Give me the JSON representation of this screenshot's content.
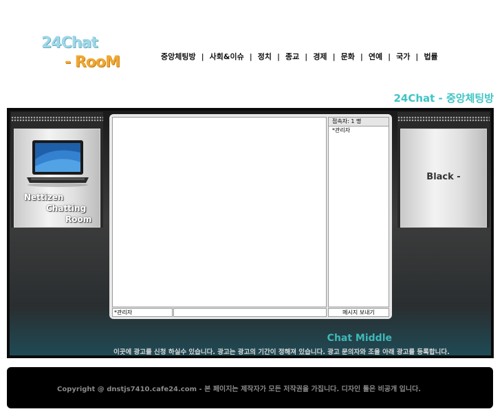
{
  "logo": {
    "line1": "24Chat",
    "line2": "- RooM"
  },
  "nav": {
    "items": [
      "중앙체팅방",
      "사회&이슈",
      "정치",
      "종교",
      "경제",
      "문화",
      "연예",
      "국가",
      "법률"
    ],
    "separator": "|"
  },
  "page_title": "24Chat - 중앙체팅방",
  "left_panel": {
    "line1": "Nettizen",
    "line2": "Chatting",
    "line3": "Room"
  },
  "right_panel": {
    "text": "Black -"
  },
  "chat": {
    "user_count_label": "접속자: 1 명",
    "users": [
      "*관리자"
    ],
    "nickname": "*관리자",
    "message_value": "",
    "send_label": "메시지 보내기"
  },
  "chat_middle_label": "Chat Middle",
  "ad_notice": "이곳에 광고를 신청 하실수 있습니다. 광고는 광고의 기간이 정해져 있습니다. 광고 문의자와 조율 아래 광고를 등록합니다.",
  "footer": {
    "text": "Copyright @ dnstjs7410.cafe24.com   -  본 페이지는 제작자가 모든 저작권을 가집니다. 디자인 툴은 비공개 입니다."
  },
  "colors": {
    "accent": "#3fc4c4",
    "logo_blue": "#9fd8e8",
    "logo_orange": "#f0a830"
  },
  "icons": {
    "laptop": "laptop-icon"
  }
}
